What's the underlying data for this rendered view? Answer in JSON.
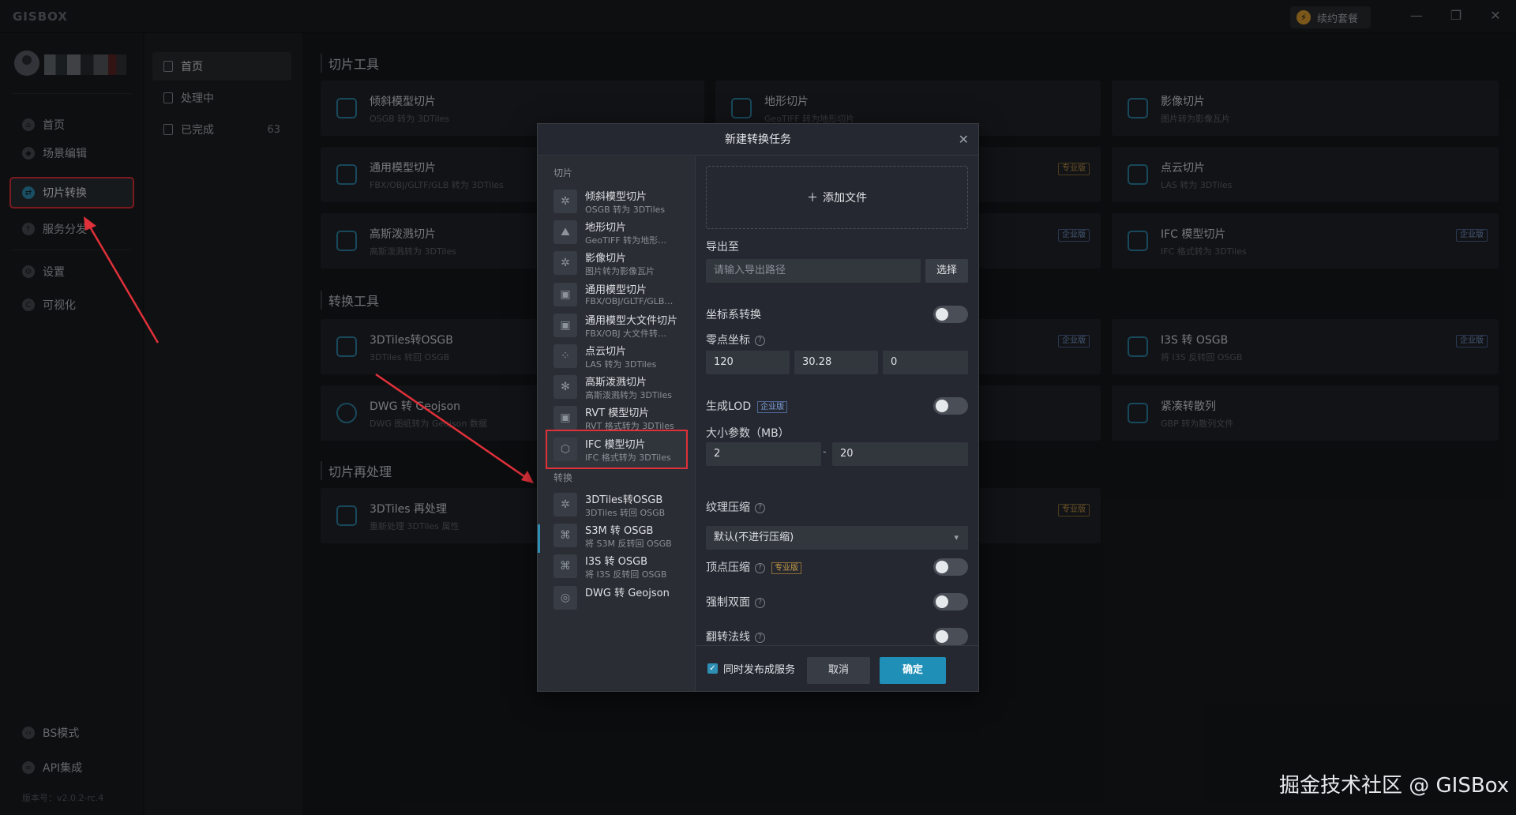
{
  "titlebar": {
    "logo": "GISBOX",
    "renew_label": "续约套餐",
    "window_controls": [
      "—",
      "❐",
      "✕"
    ]
  },
  "sidebar": {
    "items": [
      {
        "label": "首页",
        "icon": "home-icon"
      },
      {
        "label": "场景编辑",
        "icon": "cube-icon"
      },
      {
        "label": "切片转换",
        "icon": "swap-icon",
        "active": true
      },
      {
        "label": "服务分发",
        "icon": "upload-icon"
      },
      {
        "label": "设置",
        "icon": "gear-icon"
      },
      {
        "label": "可视化",
        "icon": "chart-icon"
      }
    ],
    "bottom_items": [
      {
        "label": "BS模式",
        "icon": "code-icon"
      },
      {
        "label": "API集成",
        "icon": "link-icon"
      }
    ],
    "version": "版本号：v2.0.2-rc.4"
  },
  "subbar": {
    "items": [
      {
        "label": "首页",
        "active": true
      },
      {
        "label": "处理中"
      },
      {
        "label": "已完成",
        "count": "63"
      }
    ]
  },
  "main": {
    "sections": [
      {
        "title": "切片工具"
      },
      {
        "title": "转换工具"
      },
      {
        "title": "切片再处理"
      }
    ],
    "cards": [
      {
        "title": "倾斜模型切片",
        "sub": "OSGB 转为 3DTiles"
      },
      {
        "title": "地形切片",
        "sub": "GeoTIFF 转为地形切片"
      },
      {
        "title": "影像切片",
        "sub": "图片转为影像瓦片"
      },
      {
        "title": "通用模型切片",
        "sub": "FBX/OBJ/GLTF/GLB 转为 3DTiles"
      },
      {
        "title": "点云切片",
        "sub": "LAS 转为 3DTiles"
      },
      {
        "title": "高斯泼溅切片",
        "sub": "高斯泼溅转为 3DTiles"
      },
      {
        "title": "IFC 模型切片",
        "sub": "IFC 格式转为 3DTiles"
      },
      {
        "title": "3DTiles转OSGB",
        "sub": "3DTiles 转回 OSGB"
      },
      {
        "title": "I3S 转 OSGB",
        "sub": "将 I3S 反转回 OSGB"
      },
      {
        "title": "DWG 转 Geojson",
        "sub": "DWG 图纸转为 Geojson 数据"
      },
      {
        "title": "紧凑转散列",
        "sub": "GBP 转为散列文件"
      },
      {
        "title": "3DTiles 再处理",
        "sub": "重新处理 3DTiles 属性"
      }
    ],
    "badge_pro": "专业版",
    "badge_ent": "企业版"
  },
  "dialog": {
    "title": "新建转换任务",
    "close": "✕",
    "group_slice": "切片",
    "group_convert": "转换",
    "left_items": [
      {
        "title": "倾斜模型切片",
        "sub": "OSGB 转为 3DTiles"
      },
      {
        "title": "地形切片",
        "sub": "GeoTIFF 转为地形…"
      },
      {
        "title": "影像切片",
        "sub": "图片转为影像瓦片"
      },
      {
        "title": "通用模型切片",
        "sub": "FBX/OBJ/GLTF/GLB…"
      },
      {
        "title": "通用模型大文件切片",
        "sub": "FBX/OBJ 大文件转…"
      },
      {
        "title": "点云切片",
        "sub": "LAS 转为 3DTiles"
      },
      {
        "title": "高斯泼溅切片",
        "sub": "高斯泼溅转为 3DTiles"
      },
      {
        "title": "RVT 模型切片",
        "sub": "RVT 格式转为 3DTiles"
      },
      {
        "title": "IFC 模型切片",
        "sub": "IFC 格式转为 3DTiles",
        "selected": true
      }
    ],
    "convert_items": [
      {
        "title": "3DTiles转OSGB",
        "sub": "3DTiles 转回 OSGB"
      },
      {
        "title": "S3M 转 OSGB",
        "sub": "将 S3M 反转回 OSGB"
      },
      {
        "title": "I3S 转 OSGB",
        "sub": "将 I3S 反转回 OSGB"
      },
      {
        "title": "DWG 转 Geojson",
        "sub": ""
      }
    ],
    "add_file": "添加文件",
    "export_label": "导出至",
    "export_placeholder": "请输入导出路径",
    "choose": "选择",
    "coord_transform": "坐标系转换",
    "zero_point": "零点坐标",
    "zero_x": "120",
    "zero_y": "30.28",
    "zero_z": "0",
    "gen_lod": "生成LOD",
    "size_param": "大小参数（MB）",
    "size_min": "2",
    "size_max": "20",
    "texture_compress": "纹理压缩",
    "texture_value": "默认(不进行压缩)",
    "vertex_compress": "顶点压缩",
    "force_double": "强制双面",
    "flip_normal": "翻转法线",
    "publish_service": "同时发布成服务",
    "cancel": "取消",
    "confirm": "确定"
  },
  "watermark": "掘金技术社区 @ GISBox",
  "colors": {
    "accent": "#1f8fb8",
    "highlight": "#e0313a",
    "pro": "#c79a4a",
    "enterprise": "#7ea0d8"
  }
}
